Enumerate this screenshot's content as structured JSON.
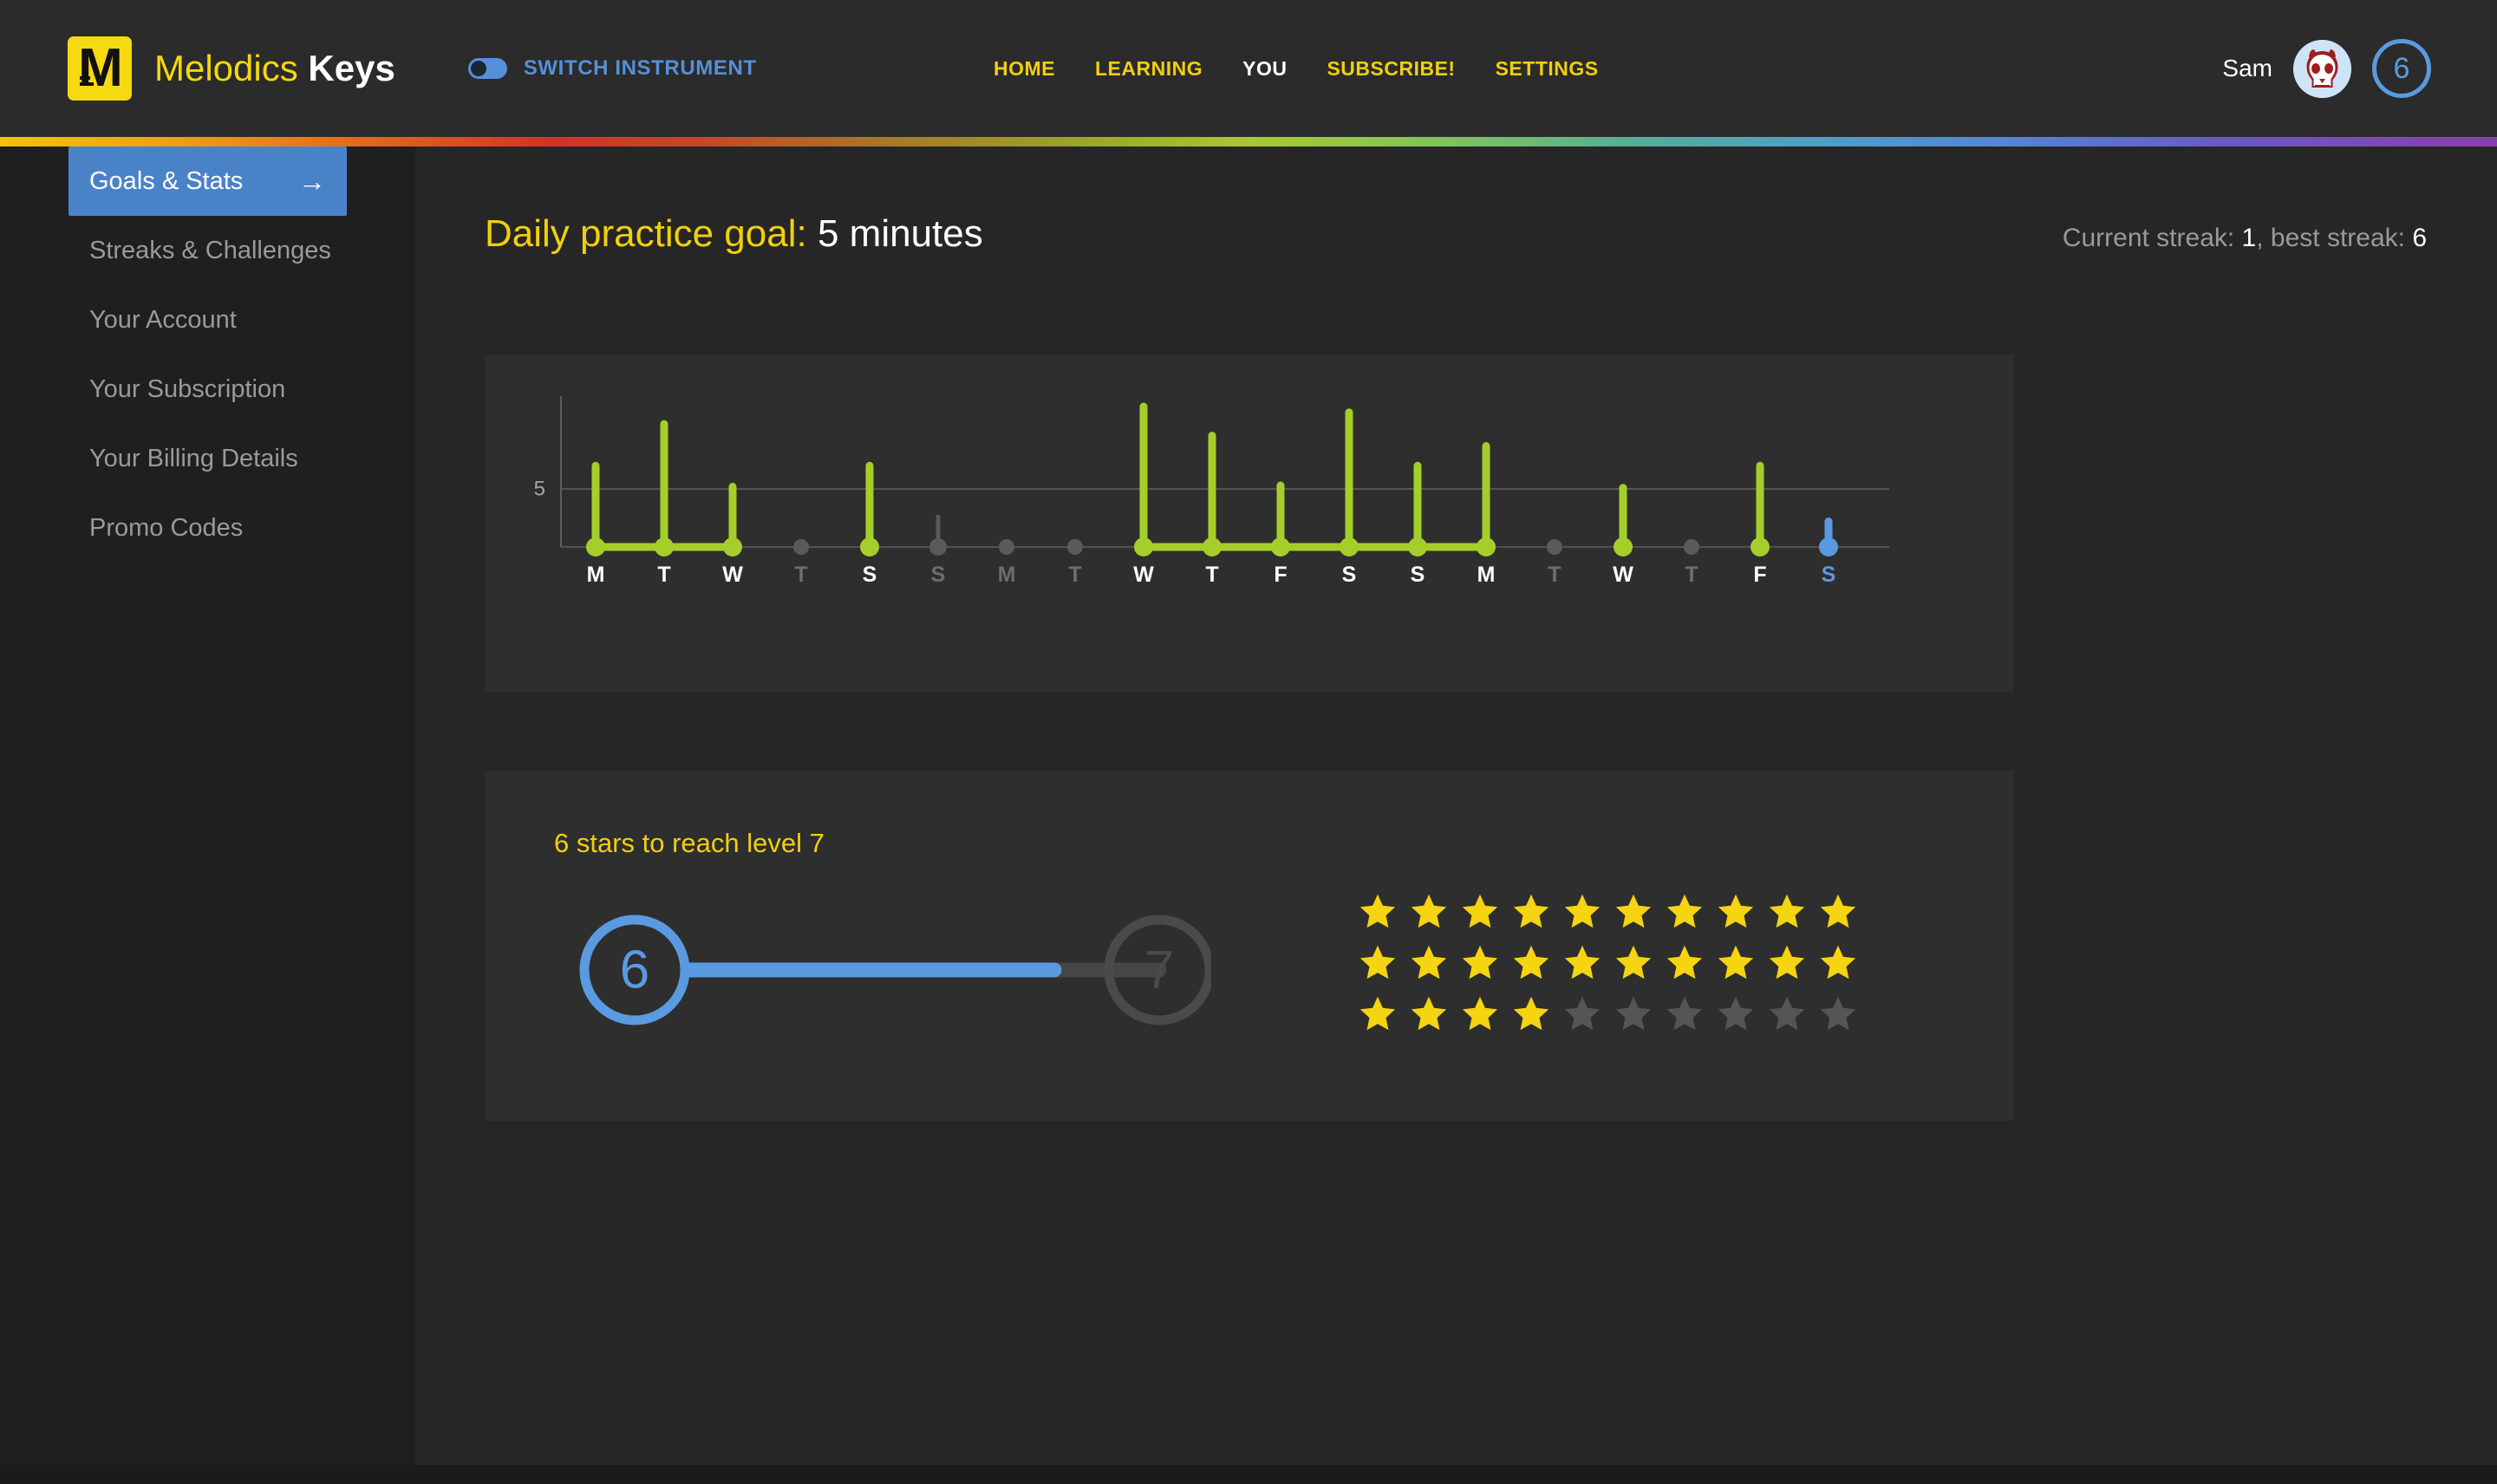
{
  "header": {
    "brand_primary": "Melodics",
    "brand_secondary": "Keys",
    "logo_letter": "M",
    "switch_instrument_label": "SWITCH INSTRUMENT",
    "nav": [
      {
        "label": "HOME",
        "active": false
      },
      {
        "label": "LEARNING",
        "active": false
      },
      {
        "label": "YOU",
        "active": true
      },
      {
        "label": "SUBSCRIBE!",
        "active": false
      },
      {
        "label": "SETTINGS",
        "active": false
      }
    ],
    "user_name": "Sam",
    "level_badge": "6"
  },
  "sidebar": {
    "items": [
      {
        "label": "Goals & Stats",
        "active": true
      },
      {
        "label": "Streaks & Challenges",
        "active": false
      },
      {
        "label": "Your Account",
        "active": false
      },
      {
        "label": "Your Subscription",
        "active": false
      },
      {
        "label": "Your Billing Details",
        "active": false
      },
      {
        "label": "Promo Codes",
        "active": false
      }
    ]
  },
  "main": {
    "goal_label": "Daily practice goal:",
    "goal_value": "5 minutes",
    "streak_prefix": "Current streak: ",
    "streak_current": "1",
    "streak_middle": ", best streak: ",
    "streak_best": "6"
  },
  "level": {
    "headline": "6 stars to reach level 7",
    "current_level": "6",
    "next_level": "7",
    "progress_percent": 80,
    "stars_total": 30,
    "stars_earned": 24,
    "stars_per_row": 10,
    "star_filled_color": "#f5d411",
    "star_empty_color": "#555555"
  },
  "colors": {
    "accent_yellow": "#f1cf0f",
    "accent_blue": "#5590d8",
    "bar_green": "#a6ce2b",
    "bar_gray": "#5a5a5a",
    "bar_today_blue": "#5a9ae0",
    "panel_bg": "#2e2e2e",
    "page_bg": "#262626",
    "sidebar_bg": "#1f1f1f"
  },
  "chart_data": {
    "type": "bar",
    "title": "",
    "xlabel": "",
    "ylabel": "",
    "grid": true,
    "ylim": [
      0,
      13
    ],
    "yticks": [
      5
    ],
    "ytick_labels": [
      "5"
    ],
    "categories": [
      "M",
      "T",
      "W",
      "T",
      "S",
      "S",
      "M",
      "T",
      "W",
      "T",
      "F",
      "S",
      "S",
      "M",
      "T",
      "W",
      "T",
      "F",
      "S"
    ],
    "values": [
      7,
      10.6,
      5.2,
      0,
      7,
      2.6,
      0,
      0,
      12.1,
      9.6,
      5.3,
      11.6,
      7,
      8.7,
      0,
      5.1,
      0,
      7,
      2.2
    ],
    "states": [
      "goal",
      "goal",
      "goal",
      "none",
      "goal",
      "partial",
      "none",
      "none",
      "goal",
      "goal",
      "goal",
      "goal",
      "goal",
      "goal",
      "none",
      "goal",
      "none",
      "goal",
      "today"
    ],
    "streak_links": [
      [
        0,
        1
      ],
      [
        1,
        2
      ],
      [
        8,
        9
      ],
      [
        9,
        10
      ],
      [
        10,
        11
      ],
      [
        11,
        12
      ],
      [
        12,
        13
      ]
    ],
    "legend": []
  }
}
